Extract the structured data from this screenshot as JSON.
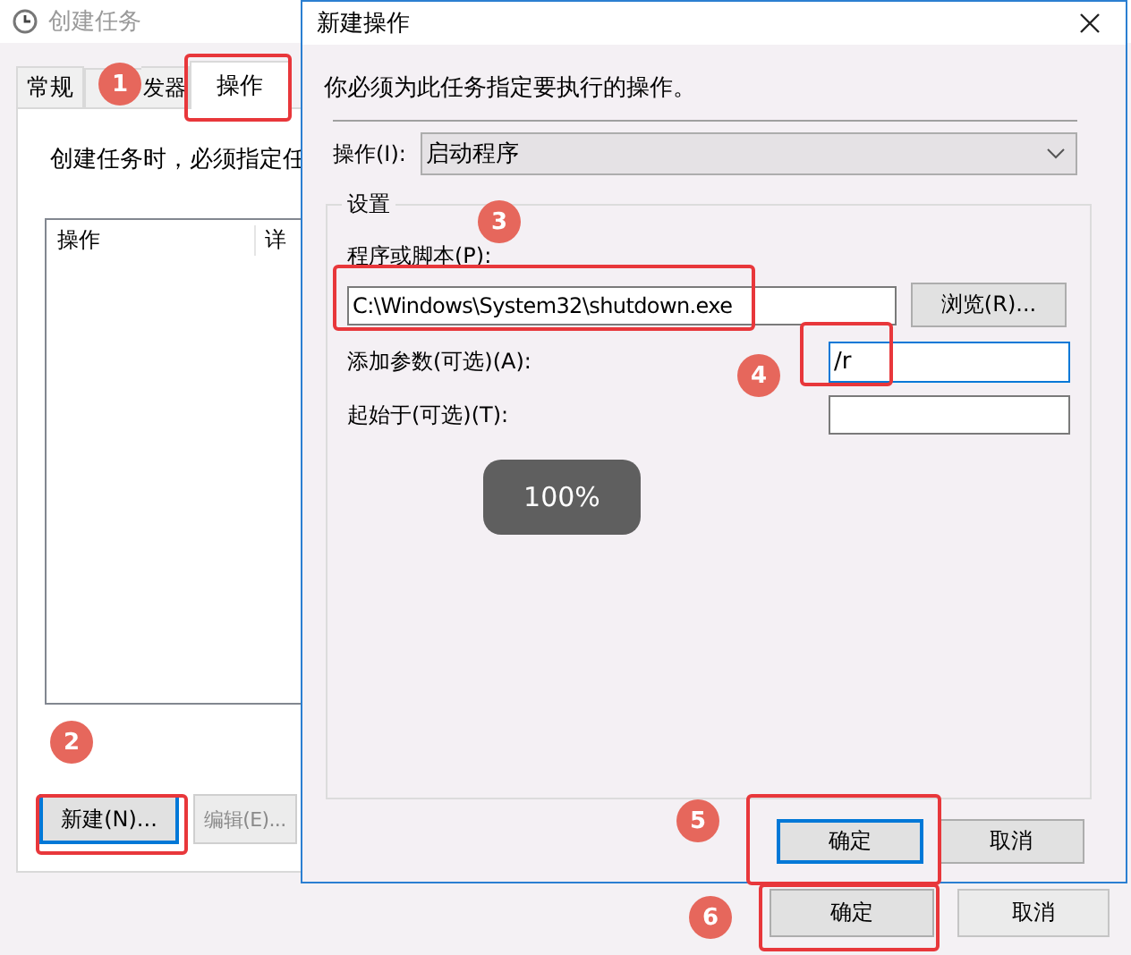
{
  "main_window": {
    "title": "创建任务",
    "tabs": [
      {
        "label": "常规",
        "selected": false
      },
      {
        "label": "发器",
        "selected": false
      },
      {
        "label": "操作",
        "selected": true
      }
    ],
    "description": "创建任务时，必须指定任",
    "list_columns": [
      "操作",
      "详"
    ],
    "buttons": [
      {
        "label": "新建(N)...",
        "disabled": false,
        "focused": true
      },
      {
        "label": "编辑(E)...",
        "disabled": true,
        "focused": false
      }
    ],
    "footer_buttons": [
      {
        "label": "确定"
      },
      {
        "label": "取消"
      }
    ]
  },
  "dialog": {
    "title": "新建操作",
    "instruction": "你必须为此任务指定要执行的操作。",
    "action_label": "操作(I):",
    "action_value": "启动程序",
    "group_title": "设置",
    "program_label": "程序或脚本(P):",
    "program_value": "C:\\Windows\\System32\\shutdown.exe",
    "browse_button": "浏览(R)...",
    "arguments_label": "添加参数(可选)(A):",
    "arguments_value": "/r",
    "start_in_label": "起始于(可选)(T):",
    "buttons": [
      {
        "label": "确定",
        "focused": true
      },
      {
        "label": "取消",
        "focused": false
      }
    ]
  },
  "toast": "100%",
  "annotations": [
    "1",
    "2",
    "3",
    "4",
    "5",
    "6"
  ]
}
